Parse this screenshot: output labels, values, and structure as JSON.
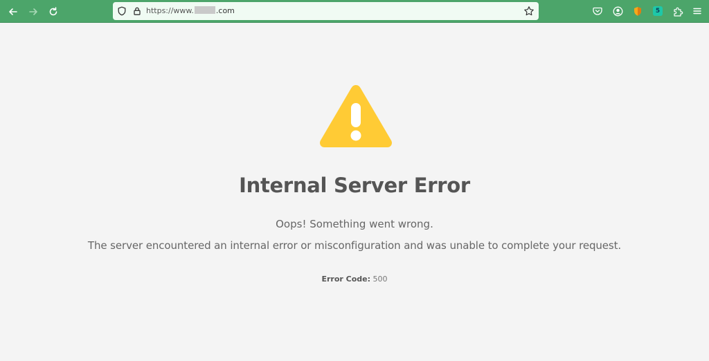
{
  "browser": {
    "url_prefix": "https://www.",
    "url_suffix": ".com",
    "extension_badge": "5",
    "colors": {
      "toolbar": "#4ca56a",
      "url_box": "#f0fbf3"
    },
    "icons": {
      "back": "back-arrow-icon",
      "forward": "forward-arrow-icon",
      "reload": "reload-icon",
      "shield": "shield-icon",
      "lock": "lock-icon",
      "bookmark": "star-icon",
      "pocket": "pocket-icon",
      "account": "account-icon",
      "ext1": "extension-shield-icon",
      "ext2": "extension-badge-icon",
      "extensions": "puzzle-icon",
      "menu": "hamburger-menu-icon"
    }
  },
  "error_page": {
    "icon": "warning-triangle-icon",
    "icon_color": "#ffcb35",
    "title": "Internal Server Error",
    "subtitle": "Oops! Something went wrong.",
    "description": "The server encountered an internal error or misconfiguration and was unable to complete your request.",
    "code_label": "Error Code:",
    "code_value": "500"
  }
}
